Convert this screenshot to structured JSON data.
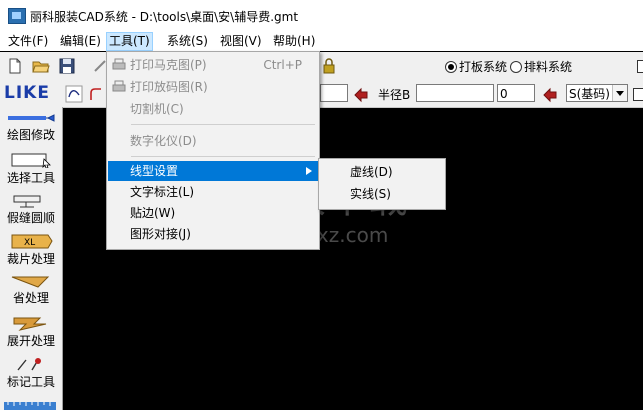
{
  "window": {
    "title": "丽科服装CAD系统 - D:\\tools\\桌面\\安\\辅导费.gmt"
  },
  "menubar": [
    {
      "label": "文件(F)"
    },
    {
      "label": "编辑(E)"
    },
    {
      "label": "工具(T)"
    },
    {
      "label": "系统(S)"
    },
    {
      "label": "视图(V)"
    },
    {
      "label": "帮助(H)"
    }
  ],
  "tools_menu": {
    "items": [
      {
        "label": "打印马克图(P)",
        "shortcut": "Ctrl+P"
      },
      {
        "label": "打印放码图(R)"
      },
      {
        "label": "切割机(C)"
      },
      {
        "label": "数字化仪(D)"
      },
      {
        "label": "线型设置"
      },
      {
        "label": "文字标注(L)"
      },
      {
        "label": "贴边(W)"
      },
      {
        "label": "图形对接(J)"
      }
    ]
  },
  "linetype_submenu": {
    "items": [
      {
        "label": "虚线(D)"
      },
      {
        "label": "实线(S)"
      }
    ]
  },
  "toolbar": {
    "radio_pattern": "打板系统",
    "radio_marker": "排料系统",
    "radius_label": "半径B",
    "radius_value": "",
    "value_field": "0",
    "base_select": "S(基码)",
    "logo": "LIKE"
  },
  "left_tools": [
    {
      "label": "绘图修改",
      "icon": "pencil-icon"
    },
    {
      "label": "选择工具",
      "icon": "select-rect-icon"
    },
    {
      "label": "假缝圆顺",
      "icon": "sewing-icon"
    },
    {
      "label": "裁片处理",
      "icon": "piece-xl-icon"
    },
    {
      "label": "省处理",
      "icon": "dart-icon"
    },
    {
      "label": "展开处理",
      "icon": "expand-icon"
    },
    {
      "label": "标记工具",
      "icon": "marker-icon"
    }
  ],
  "watermark": {
    "cn": "安下载",
    "en": "anxz.com"
  },
  "colors": {
    "highlight": "#0078d7",
    "menu_active": "#cce8ff",
    "canvas": "#000000"
  }
}
